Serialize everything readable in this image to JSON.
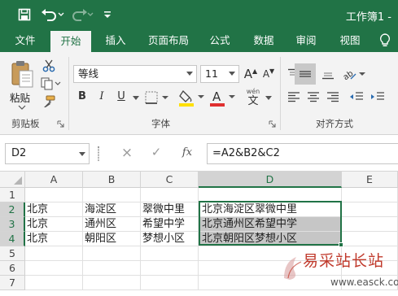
{
  "window": {
    "title": "工作簿1 -",
    "accent_color": "#217346"
  },
  "quick_access": [
    "save-icon",
    "undo-icon",
    "redo-icon"
  ],
  "ribbon_tabs": [
    "文件",
    "开始",
    "插入",
    "页面布局",
    "公式",
    "数据",
    "审阅",
    "视图"
  ],
  "ribbon_active_tab": "开始",
  "clipboard": {
    "paste_label": "粘贴",
    "group_label": "剪贴板"
  },
  "font": {
    "name": "等线",
    "size": "11",
    "group_label": "字体",
    "bold": "B",
    "italic": "I",
    "underline": "U",
    "grow": "A",
    "shrink": "A",
    "phonetic_top": "wén",
    "phonetic_bottom": "文",
    "fill_color": "#ffe000",
    "font_color": "#e03030"
  },
  "alignment": {
    "group_label": "对齐方式"
  },
  "formula_bar": {
    "name_box": "D2",
    "cancel": "×",
    "enter": "✓",
    "fx": "fx",
    "formula": "=A2&B2&C2"
  },
  "grid": {
    "columns": [
      "A",
      "B",
      "C",
      "D",
      "E"
    ],
    "selected_column": "D",
    "rows": [
      {
        "number": "1",
        "cells": [
          "",
          "",
          "",
          ""
        ]
      },
      {
        "number": "2",
        "cells": [
          "北京",
          "海淀区",
          "翠微中里",
          "北京海淀区翠微中里"
        ]
      },
      {
        "number": "3",
        "cells": [
          "北京",
          "通州区",
          "希望中学",
          "北京通州区希望中学"
        ]
      },
      {
        "number": "4",
        "cells": [
          "北京",
          "朝阳区",
          "梦想小区",
          "北京朝阳区梦想小区"
        ]
      },
      {
        "number": "5",
        "cells": [
          "",
          "",
          "",
          ""
        ]
      },
      {
        "number": "6",
        "cells": [
          "",
          "",
          "",
          ""
        ]
      },
      {
        "number": "7",
        "cells": [
          "",
          "",
          "",
          ""
        ]
      }
    ]
  },
  "watermark": {
    "text": "易采站长站",
    "url": "www.easck.com"
  }
}
